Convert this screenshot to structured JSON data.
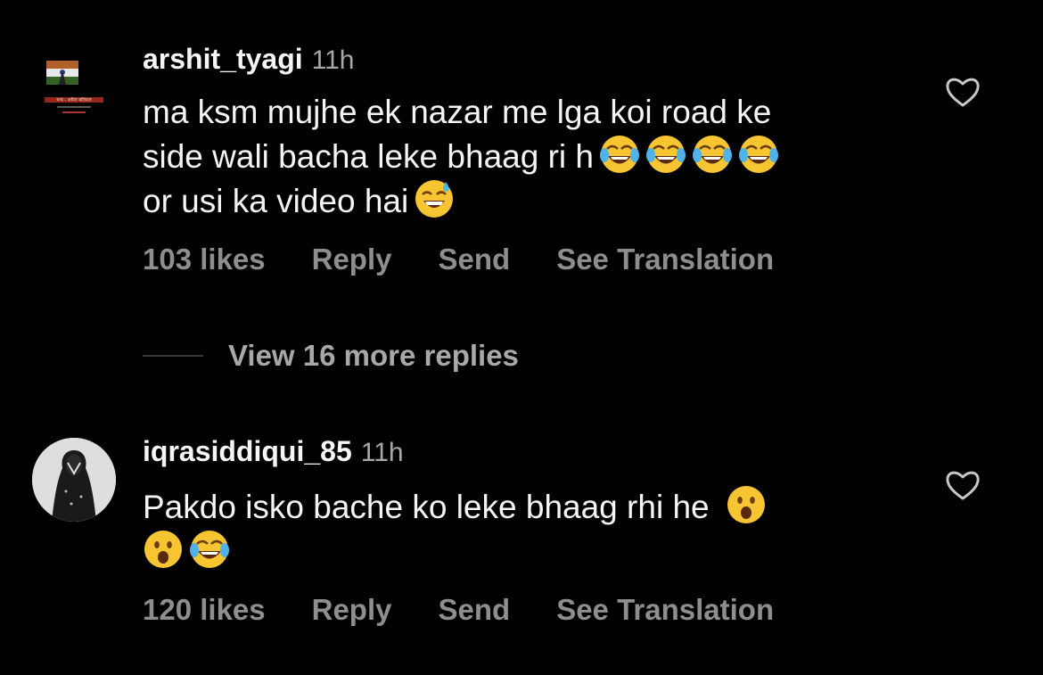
{
  "comments": [
    {
      "username": "arshit_tyagi",
      "time": "11h",
      "text_lines": [
        "ma ksm mujhe ek nazar me lga koi road ke",
        "side wali bacha leke bhaag ri h",
        "or usi ka video hai"
      ],
      "likes": "103 likes",
      "reply_label": "Reply",
      "send_label": "Send",
      "translate_label": "See Translation",
      "avatar_text": "धन्य - अमित बलिदान"
    },
    {
      "username": "iqrasiddiqui_85",
      "time": "11h",
      "text_lines": [
        "Pakdo isko bache ko leke bhaag rhi he"
      ],
      "likes": "120 likes",
      "reply_label": "Reply",
      "send_label": "Send",
      "translate_label": "See Translation"
    }
  ],
  "view_more_replies": "View 16 more replies",
  "icons": {
    "like": "heart-outline-icon",
    "laugh": "face-with-tears-of-joy-emoji",
    "sweat": "grinning-face-with-sweat-emoji",
    "surprised": "face-with-open-mouth-emoji"
  },
  "colors": {
    "background": "#000000",
    "primary_text": "#f5f5f5",
    "secondary_text": "#8e8e8e"
  }
}
